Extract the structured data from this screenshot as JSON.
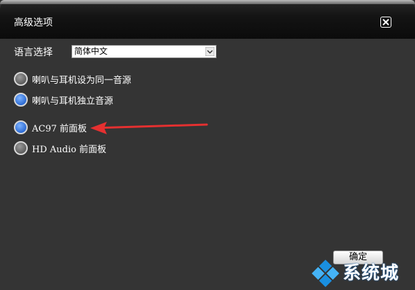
{
  "window": {
    "title": "高级选项"
  },
  "language": {
    "label": "语言选择",
    "selected": "简体中文"
  },
  "options": [
    {
      "label": "喇叭与耳机设为同一音源",
      "selected": false,
      "color": "#6e6e6e"
    },
    {
      "label": "喇叭与耳机独立音源",
      "selected": true,
      "color": "#2d6bd3"
    },
    {
      "label": "AC97 前面板",
      "selected": true,
      "color": "#2d6bd3"
    },
    {
      "label": "HD Audio 前面板",
      "selected": false,
      "color": "#6e6e6e"
    }
  ],
  "buttons": {
    "ok": "确定"
  },
  "watermark": {
    "text": "系统城"
  },
  "colors": {
    "annotation_arrow": "#e53030",
    "accent": "#2d6bd3"
  },
  "icons": {
    "close": "close-icon",
    "dropdown": "chevron-down-icon",
    "logo": "windows-logo-icon"
  }
}
